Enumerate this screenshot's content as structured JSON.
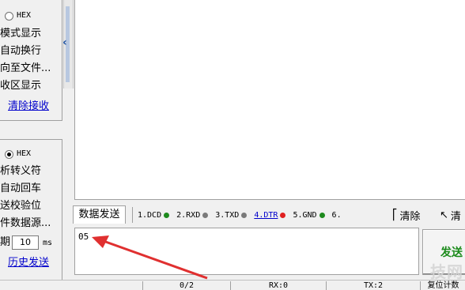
{
  "receive_settings": {
    "hex_label": "HEX",
    "mode_display": "模式显示",
    "auto_wrap": "自动换行",
    "redirect_file": "向至文件...",
    "recv_display": "收区显示",
    "clear_recv_link": "清除接收"
  },
  "send_settings": {
    "hex_label": "HEX",
    "escape_chars": "析转义符",
    "auto_enter": "自动回车",
    "checksum": "送校验位",
    "file_source": "件数据源...",
    "period_label": "期",
    "period_value": "10",
    "period_unit": "ms",
    "history_link": "历史发送"
  },
  "tabs": {
    "send_tab": "数据发送"
  },
  "signals": [
    {
      "label": "1.DCD",
      "color": "#1e8a1e"
    },
    {
      "label": "2.RXD",
      "color": "#7a7a7a"
    },
    {
      "label": "3.TXD",
      "color": "#7a7a7a"
    },
    {
      "label": "4.DTR",
      "color": "#e02020"
    },
    {
      "label": "5.GND",
      "color": "#1e8a1e"
    },
    {
      "label": "6."
    }
  ],
  "toolbar": {
    "clear_label": "清除",
    "clear2_label": "清"
  },
  "send_input": {
    "value": "05"
  },
  "send_button": {
    "label": "发送"
  },
  "status": {
    "count": "0/2",
    "rx": "RX:0",
    "tx": "TX:2",
    "reset": "复位计数"
  },
  "watermark": "技网"
}
